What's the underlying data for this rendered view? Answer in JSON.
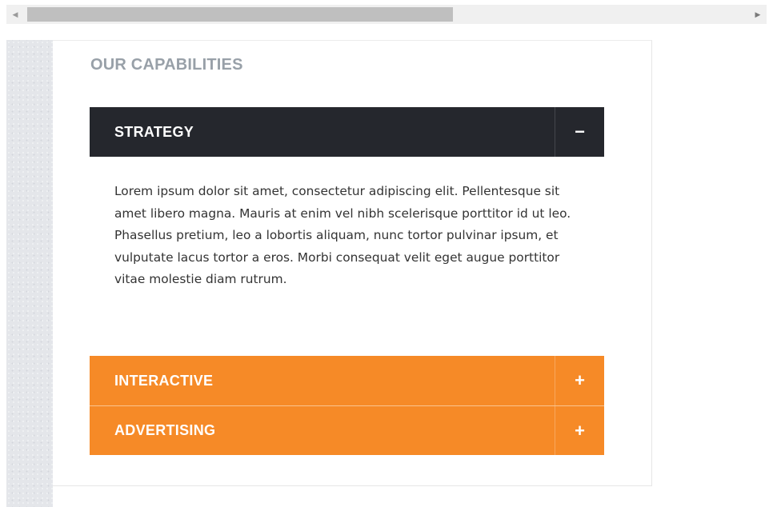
{
  "scrollbar": {
    "left_arrow_icon": "triangle-left-icon",
    "right_arrow_icon": "triangle-right-icon"
  },
  "section": {
    "title": "OUR CAPABILITIES"
  },
  "accordion": {
    "items": [
      {
        "label": "STRATEGY",
        "expanded": true,
        "toggle_symbol": "−",
        "toggle_icon": "minus-icon",
        "content": "Lorem ipsum dolor sit amet, consectetur adipiscing elit. Pellentesque sit amet libero magna. Mauris at enim vel nibh scelerisque porttitor id ut leo. Phasellus pretium, leo a lobortis aliquam, nunc tortor pulvinar ipsum, et vulputate lacus tortor a eros. Morbi consequat velit eget augue porttitor vitae molestie diam rutrum."
      },
      {
        "label": "INTERACTIVE",
        "expanded": false,
        "toggle_symbol": "+",
        "toggle_icon": "plus-icon"
      },
      {
        "label": "ADVERTISING",
        "expanded": false,
        "toggle_symbol": "+",
        "toggle_icon": "plus-icon"
      }
    ]
  },
  "colors": {
    "active_header": "#25272d",
    "inactive_header": "#f68a27",
    "section_title": "#98a0a8",
    "body_text": "#333333"
  }
}
